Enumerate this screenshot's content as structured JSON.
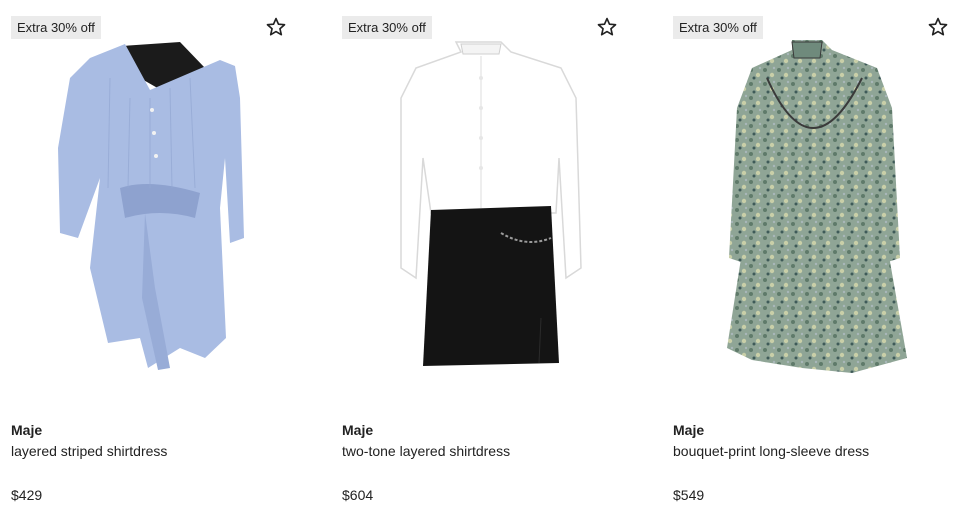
{
  "products": [
    {
      "badge": "Extra 30% off",
      "brand": "Maje",
      "title": "layered striped shirtdress",
      "price": "$429"
    },
    {
      "badge": "Extra 30% off",
      "brand": "Maje",
      "title": "two-tone layered shirtdress",
      "price": "$604"
    },
    {
      "badge": "Extra 30% off",
      "brand": "Maje",
      "title": "bouquet-print long-sleeve dress",
      "price": "$549"
    }
  ],
  "colors": {
    "badge_bg": "#ebebeb",
    "text": "#222222",
    "dress1": "#a9bce3",
    "dress2_top": "#ffffff",
    "dress2_bottom": "#141414",
    "dress3": "#8fa596"
  },
  "icons": {
    "favorite": "star-outline-icon"
  }
}
